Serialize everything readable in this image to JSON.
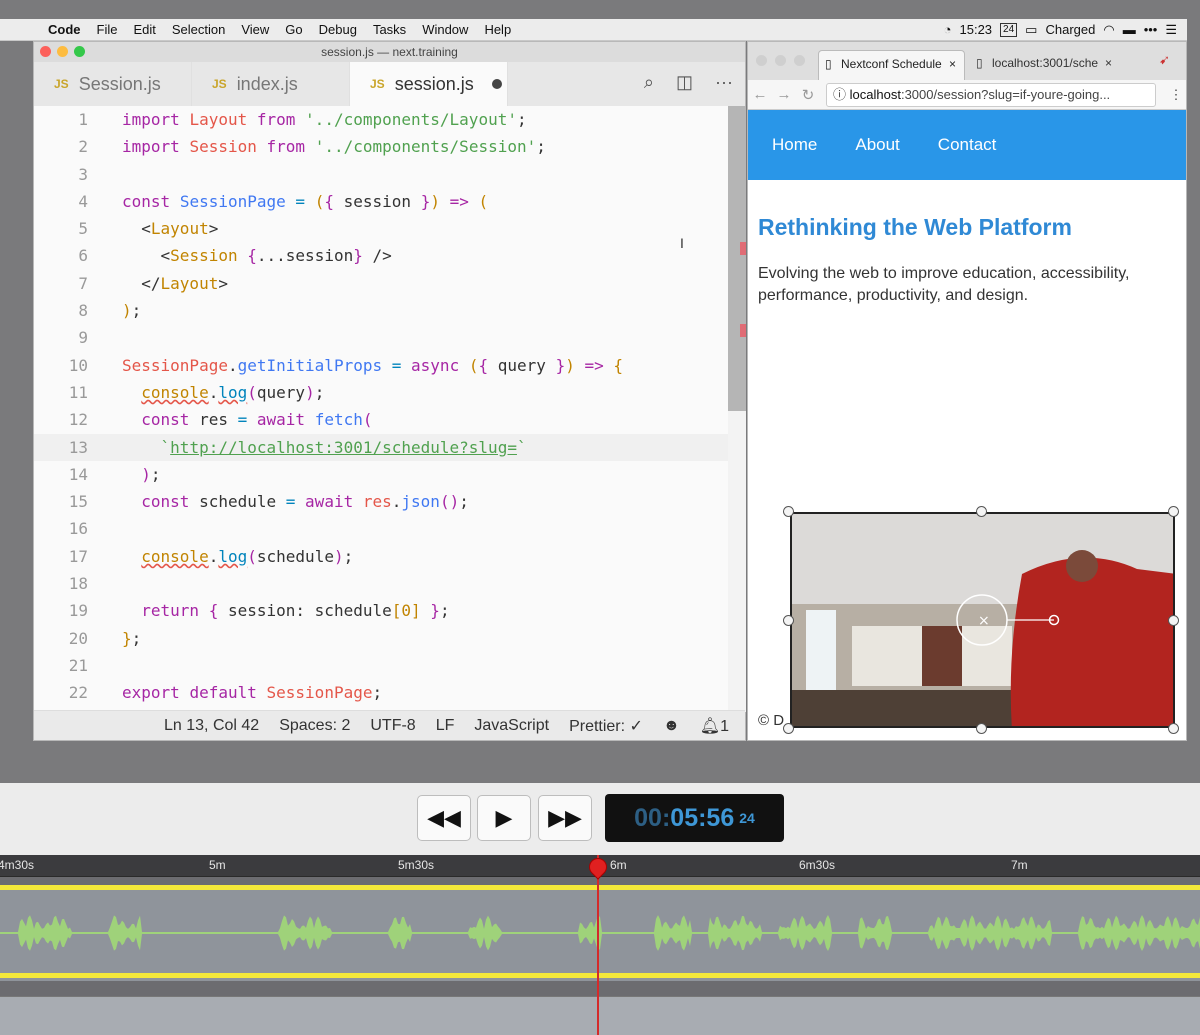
{
  "menubar": {
    "app": "Code",
    "items": [
      "File",
      "Edit",
      "Selection",
      "View",
      "Go",
      "Debug",
      "Tasks",
      "Window",
      "Help"
    ],
    "clock": "15:23",
    "date_badge": "24",
    "battery": "Charged"
  },
  "editor": {
    "window_title": "session.js — next.training",
    "tabs": [
      {
        "label": "Session.js",
        "badge": "JS"
      },
      {
        "label": "index.js",
        "badge": "JS"
      },
      {
        "label": "session.js",
        "badge": "JS"
      }
    ],
    "line_numbers": [
      "1",
      "2",
      "3",
      "4",
      "5",
      "6",
      "7",
      "8",
      "9",
      "10",
      "11",
      "12",
      "13",
      "14",
      "15",
      "16",
      "17",
      "18",
      "19",
      "20",
      "21",
      "22"
    ],
    "status": {
      "position": "Ln 13, Col 42",
      "spaces": "Spaces: 2",
      "encoding": "UTF-8",
      "eol": "LF",
      "language": "JavaScript",
      "prettier": "Prettier: ✓",
      "notifications": "1"
    }
  },
  "browser": {
    "tabs": [
      "Nextconf Schedule",
      "localhost:3001/sche"
    ],
    "url_host": "localhost",
    "url_rest": ":3000/session?slug=if-youre-going...",
    "nav": [
      "Home",
      "About",
      "Contact"
    ],
    "title": "Rethinking the Web Platform",
    "description": "Evolving the web to improve education, accessibility, performance, productivity, and design.",
    "footer": "© D"
  },
  "playback": {
    "timecode_dim": "00:",
    "timecode_main": "05:56",
    "timecode_frames": "24",
    "ruler_ticks": [
      "4m30s",
      "5m",
      "5m30s",
      "6m",
      "6m30s",
      "7m"
    ]
  },
  "colors": {
    "accent_blue": "#2996e8",
    "title_blue": "#2f89d5",
    "waveform": "#9fd27a",
    "playhead": "#d42a2a",
    "track_yellow": "#f4e83a"
  }
}
